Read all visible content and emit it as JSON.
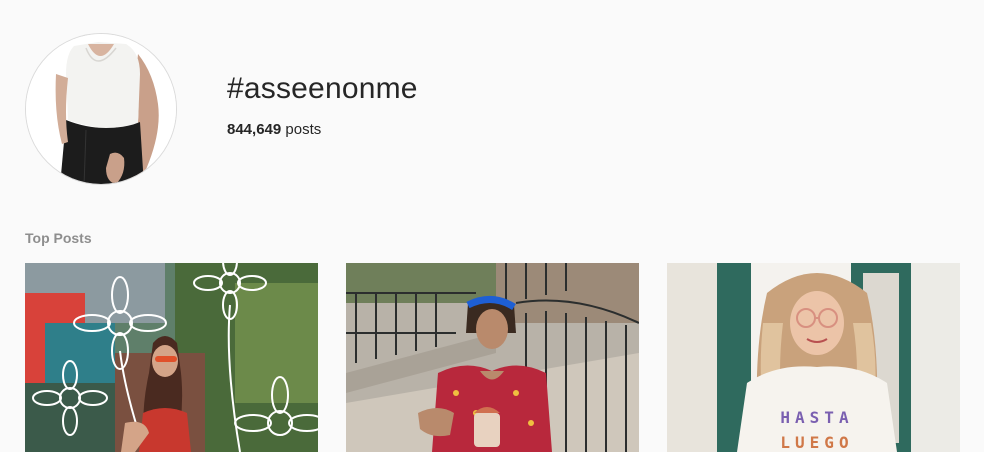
{
  "hashtag": {
    "title": "#asseenonme",
    "post_count": "844,649",
    "post_count_suffix": " posts"
  },
  "sections": {
    "top_posts_label": "Top Posts"
  },
  "top_posts": [
    {
      "description": "woman in red dress with painted flower mural"
    },
    {
      "description": "woman in floral dress holding drink on stairs"
    },
    {
      "description": "woman wearing graphic tee"
    }
  ],
  "tshirt_text": {
    "line1": "HASTA",
    "line2": "LUEGO"
  },
  "colors": {
    "background": "#fafafa",
    "text_primary": "#262626",
    "text_secondary": "#8e8e8e",
    "border": "#dbdbdb"
  }
}
